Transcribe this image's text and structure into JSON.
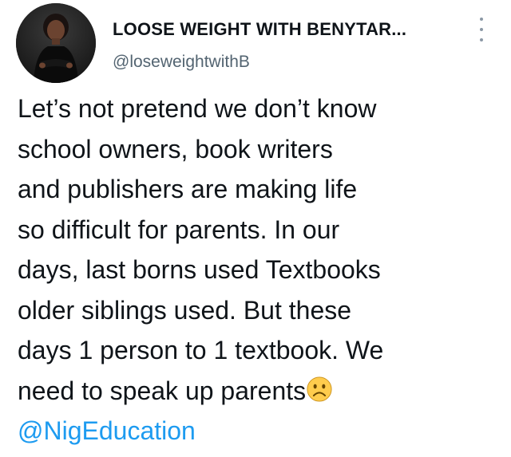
{
  "tweet": {
    "display_name": "LOOSE WEIGHT WITH BENYTAR...",
    "handle": "@loseweightwithB",
    "body_lines": [
      "Let’s not pretend we don’t know",
      "school owners, book writers",
      "and publishers are making life",
      "so difficult for parents. In our",
      "days, last borns used Textbooks",
      "older siblings used. But these",
      "days 1 person to 1 textbook. We",
      "need to speak up parents"
    ],
    "emoji": "frowning-face-emoji",
    "mention": "@NigEducation"
  },
  "colors": {
    "text": "#0f1419",
    "secondary": "#536471",
    "link": "#1d9bf0",
    "background": "#ffffff"
  },
  "icons": {
    "more": "more-options-icon",
    "avatar": "profile-avatar"
  }
}
